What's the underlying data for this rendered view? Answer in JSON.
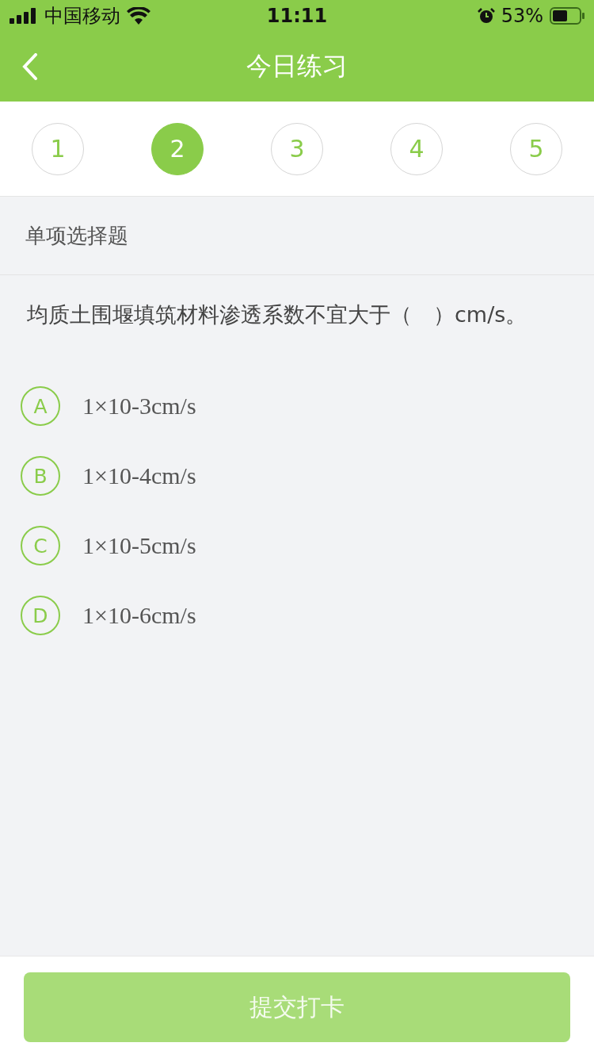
{
  "status_bar": {
    "carrier": "中国移动",
    "time": "11:11",
    "battery": "53%"
  },
  "nav": {
    "title": "今日练习"
  },
  "steps": [
    {
      "label": "1",
      "selected": false
    },
    {
      "label": "2",
      "selected": true
    },
    {
      "label": "3",
      "selected": false
    },
    {
      "label": "4",
      "selected": false
    },
    {
      "label": "5",
      "selected": false
    }
  ],
  "section_title": "单项选择题",
  "question": "均质土围堰填筑材料渗透系数不宜大于（　）cm/s。",
  "options": [
    {
      "letter": "A",
      "text": "1×10-3cm/s",
      "selected": false
    },
    {
      "letter": "B",
      "text": "1×10-4cm/s",
      "selected": false
    },
    {
      "letter": "C",
      "text": "1×10-5cm/s",
      "selected": false
    },
    {
      "letter": "D",
      "text": "1×10-6cm/s",
      "selected": false
    }
  ],
  "submit": {
    "label": "提交打卡",
    "disabled": true
  }
}
